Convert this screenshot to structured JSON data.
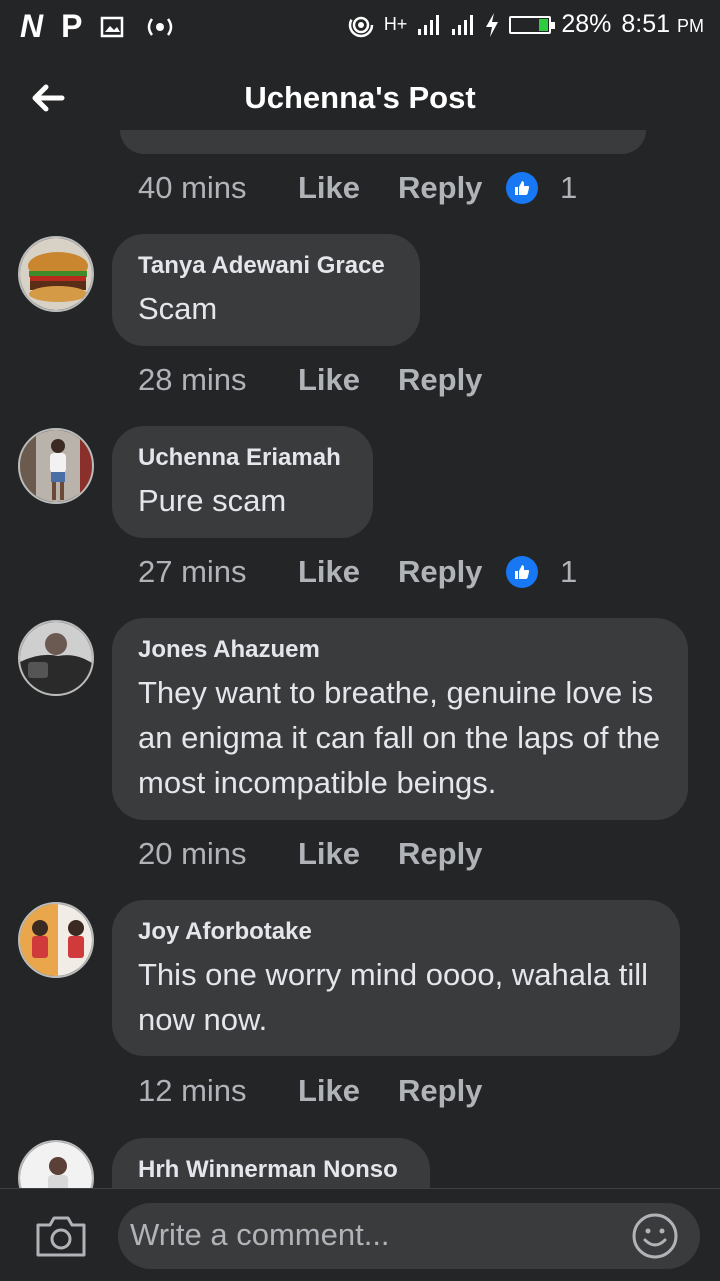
{
  "status": {
    "logo_n": "N",
    "logo_p": "P",
    "network_label": "H+",
    "battery": "28%",
    "time": "8:51",
    "ampm": "PM"
  },
  "header": {
    "title": "Uchenna's Post"
  },
  "actions": {
    "like": "Like",
    "reply": "Reply"
  },
  "top_meta": {
    "time": "40 mins",
    "reactions": "1"
  },
  "comments": [
    {
      "author": "Tanya Adewani Grace",
      "text": "Scam",
      "time": "28 mins",
      "reactions": ""
    },
    {
      "author": "Uchenna Eriamah",
      "text": "Pure scam",
      "time": "27 mins",
      "reactions": "1"
    },
    {
      "author": "Jones Ahazuem",
      "text": "They want to breathe, genuine love is an enigma it can fall on the laps of the most incompatible beings.",
      "time": "20 mins",
      "reactions": ""
    },
    {
      "author": "Joy Aforbotake",
      "text": "This one worry mind oooo, wahala till now now.",
      "time": "12 mins",
      "reactions": ""
    },
    {
      "author": "Hrh Winnerman Nonso",
      "text": "",
      "time": "",
      "reactions": ""
    }
  ],
  "composer": {
    "placeholder": "Write a comment..."
  },
  "icons": {
    "back": "arrow-left-icon",
    "camera": "camera-icon",
    "emoji": "smiley-icon",
    "like_reaction": "thumbs-up-icon"
  },
  "colors": {
    "background": "#242526",
    "bubble": "#3a3b3c",
    "accent": "#1877f2",
    "muted_text": "#b0b3b8"
  }
}
